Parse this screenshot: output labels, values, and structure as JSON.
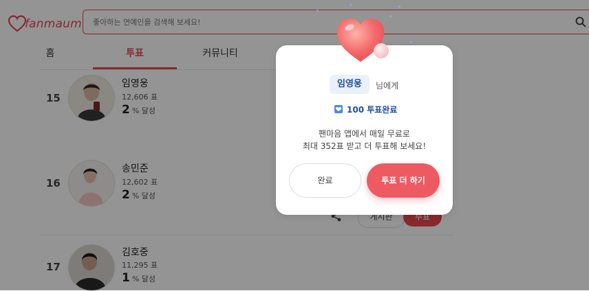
{
  "header": {
    "logo_text": "fanmaum",
    "search_placeholder": "좋아하는 연예인을 검색해 보세요!"
  },
  "tabs": [
    {
      "label": "홈",
      "active": false
    },
    {
      "label": "투표",
      "active": true
    },
    {
      "label": "커뮤니티",
      "active": false
    }
  ],
  "ranking": [
    {
      "rank": "15",
      "name": "임영웅",
      "votes": "12,606 표",
      "percent": "2",
      "percent_suffix": "% 달성"
    },
    {
      "rank": "16",
      "name": "송민준",
      "votes": "12,602 표",
      "percent": "2",
      "percent_suffix": "% 달성"
    },
    {
      "rank": "17",
      "name": "김호중",
      "votes": "11,295 표",
      "percent": "1",
      "percent_suffix": "% 달성"
    }
  ],
  "row_actions": {
    "board_label": "게시판",
    "vote_label": "투표"
  },
  "modal": {
    "idol_name": "임영웅",
    "to_suffix": "님에게",
    "done_text": "100 투표완료",
    "message_line1": "팬마음 앱에서 매일 무료로",
    "message_line2": "최대 352표 받고 더 투표해 보세요!",
    "complete_button": "완료",
    "more_button": "투표 더 하기"
  },
  "colors": {
    "brand": "#e9474f",
    "button_primary": "#ee5a62",
    "chip_text": "#1f4f9e",
    "chip_bg": "#eaf1fb"
  },
  "icons": [
    "fanmaum-logo-icon",
    "search-icon",
    "share-icon",
    "heart-icon",
    "check-heart-icon"
  ]
}
